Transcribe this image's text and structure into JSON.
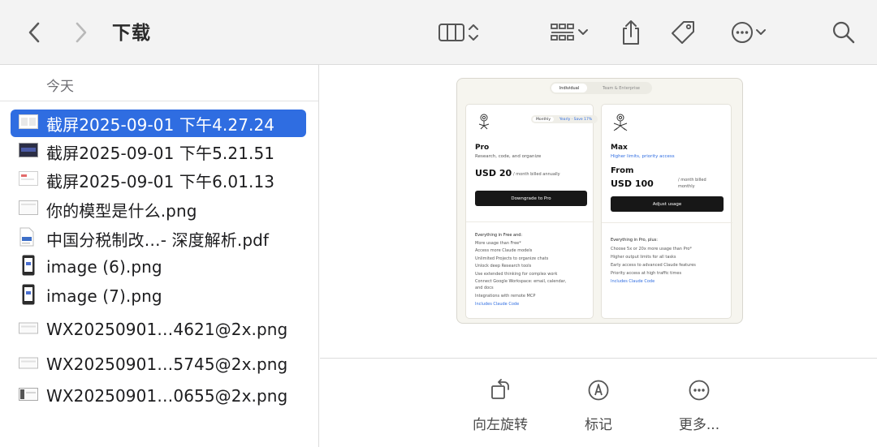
{
  "toolbar": {
    "title": "下载",
    "icons": [
      "back-chevron-icon",
      "forward-chevron-icon",
      "column-view-icon",
      "updown-chevron-icon",
      "grid-group-icon",
      "chevron-down-icon",
      "share-icon",
      "tag-icon",
      "more-circle-icon",
      "chevron-down-icon",
      "search-icon"
    ]
  },
  "list": {
    "section": "今天",
    "files": [
      {
        "name": "截屏2025-09-01 下午4.27.24",
        "icon": "screenshot-thumb-icon",
        "selected": true
      },
      {
        "name": "截屏2025-09-01 下午5.21.51",
        "icon": "screenshot-dark-thumb-icon",
        "selected": false
      },
      {
        "name": "截屏2025-09-01 下午6.01.13",
        "icon": "screenshot-red-thumb-icon",
        "selected": false
      },
      {
        "name": "你的模型是什么.png",
        "icon": "image-thumb-icon",
        "selected": false
      },
      {
        "name": "中国分税制改…- 深度解析.pdf",
        "icon": "pdf-thumb-icon",
        "selected": false
      },
      {
        "name": "image (6).png",
        "icon": "phone-image-thumb-icon",
        "selected": false
      },
      {
        "name": "image (7).png",
        "icon": "phone-image-thumb-icon",
        "selected": false
      },
      {
        "name": "WX20250901…4621@2x.png",
        "icon": "image-thumb-icon",
        "selected": false
      },
      {
        "name": "WX20250901…5745@2x.png",
        "icon": "image-thumb-icon",
        "selected": false
      },
      {
        "name": "WX20250901…0655@2x.png",
        "icon": "image-thumb-icon",
        "selected": false
      }
    ]
  },
  "preview": {
    "tabs": {
      "individual": "Individual",
      "team": "Team & Enterprise"
    },
    "pro": {
      "toggle_monthly": "Monthly",
      "toggle_yearly": "Yearly · Save 17%",
      "name": "Pro",
      "desc": "Research, code, and organize",
      "price": "USD 20",
      "price_note": "/ month billed annually",
      "button": "Downgrade to Pro",
      "features_title": "Everything in Free and:",
      "features": [
        "More usage than Free*",
        "Access more Claude models",
        "Unlimited Projects to organize chats",
        "Unlock deep Research tools",
        "Use extended thinking for complex work",
        "Connect Google Workspace: email, calendar,",
        "and docs",
        "Integrations with remote MCP"
      ],
      "link": "Includes Claude Code"
    },
    "max": {
      "name": "Max",
      "desc": "Higher limits, priority access",
      "price_from": "From",
      "price": "USD 100",
      "price_note_1": "/ month billed",
      "price_note_2": "monthly",
      "button": "Adjust usage",
      "features_title": "Everything in Pro, plus:",
      "features": [
        "Choose 5x or 20x more usage than Pro*",
        "Higher output limits for all tasks",
        "Early access to advanced Claude features",
        "Priority access at high traffic times"
      ],
      "link": "Includes Claude Code"
    }
  },
  "actions": {
    "rotate_label": "向左旋转",
    "markup_label": "标记",
    "more_label": "更多..."
  },
  "colors": {
    "accent": "#2f6de1",
    "toolbar_bg": "#f3f3f3"
  }
}
